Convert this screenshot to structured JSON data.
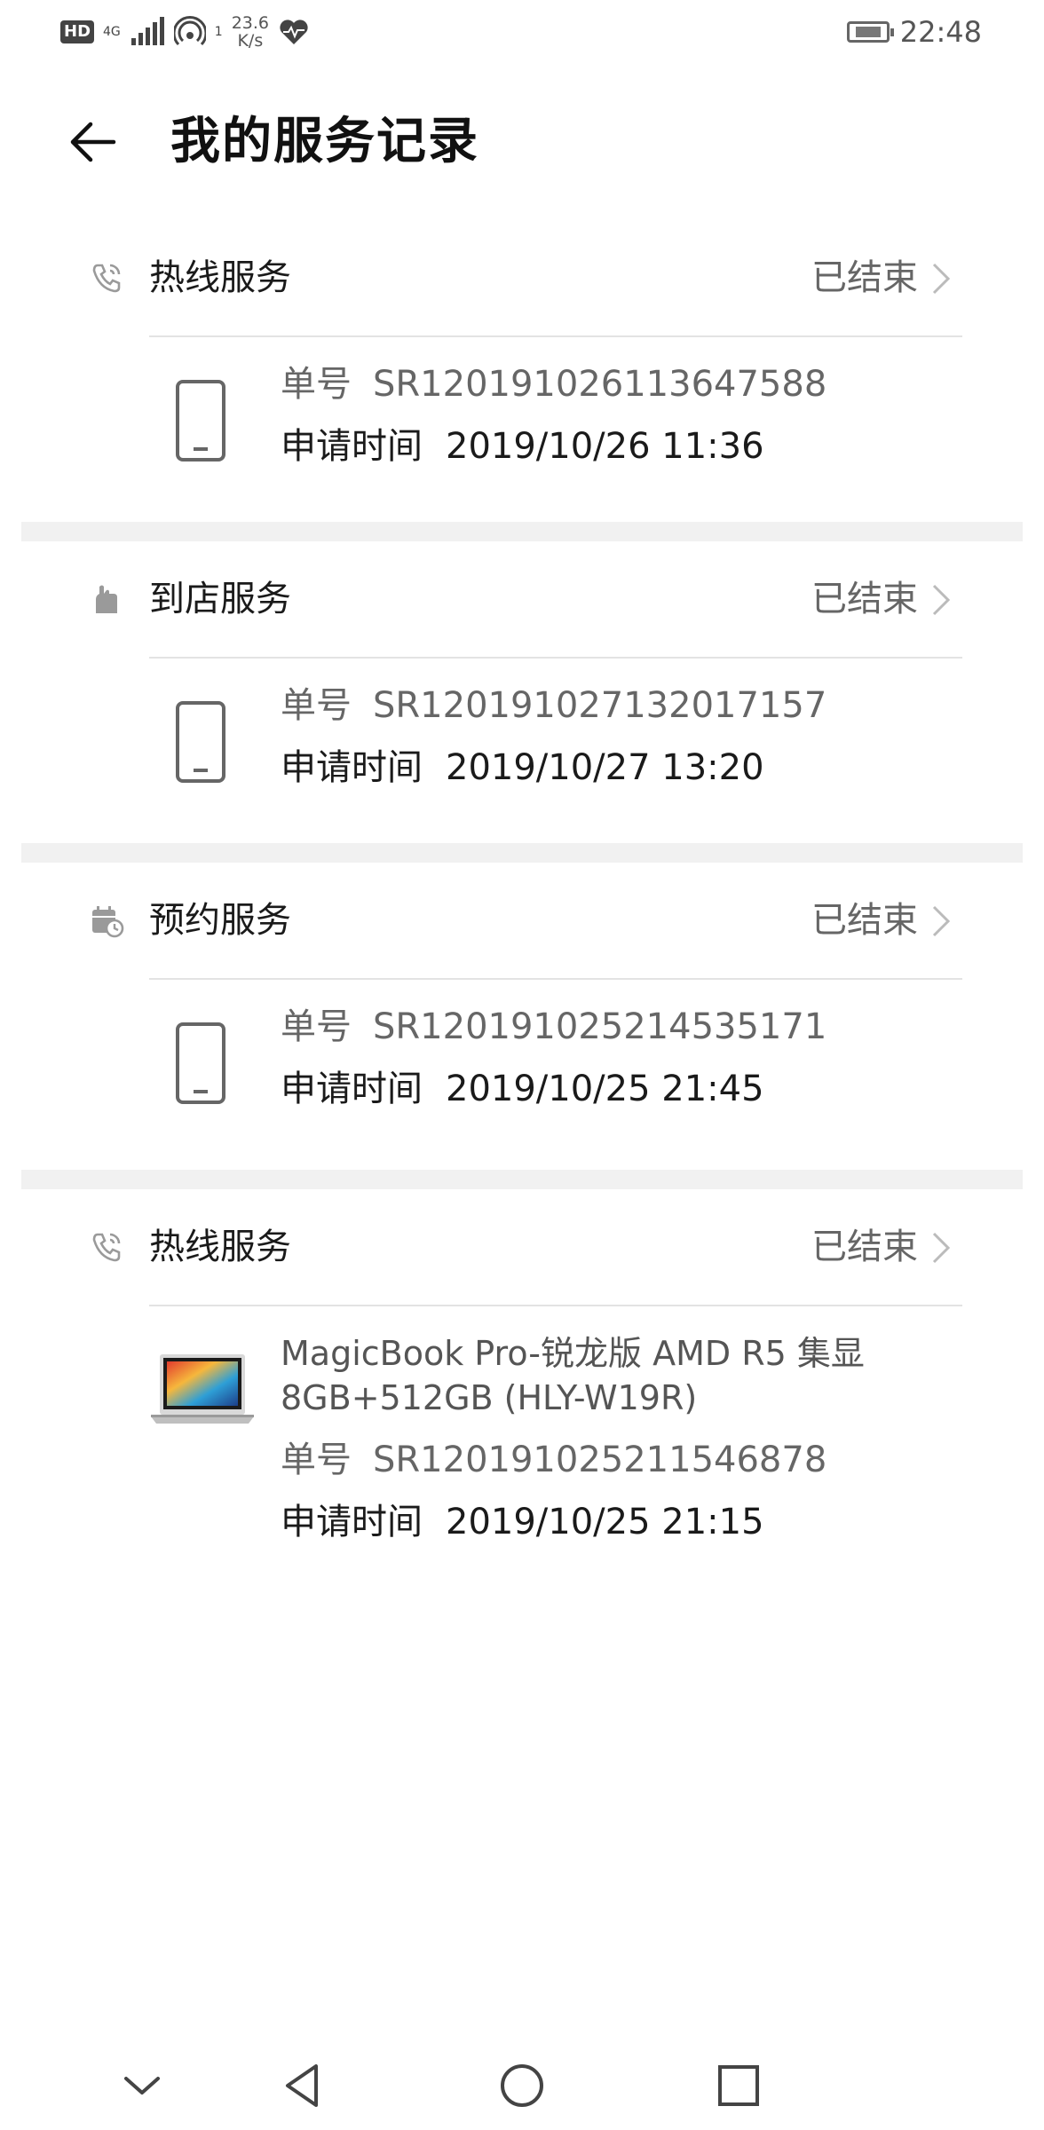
{
  "status_bar": {
    "hd": "HD",
    "network": "4G",
    "hotspot_count": "1",
    "speed_value": "23.6",
    "speed_unit": "K/s",
    "time": "22:48"
  },
  "header": {
    "title": "我的服务记录"
  },
  "records": [
    {
      "type_icon": "phone-call-icon",
      "type": "热线服务",
      "status": "已结束",
      "device_icon": "smartphone-icon",
      "product": "",
      "order_label": "单号",
      "order_no": "SR120191026113647588",
      "time_label": "申请时间",
      "time": "2019/10/26 11:36"
    },
    {
      "type_icon": "hand-store-icon",
      "type": "到店服务",
      "status": "已结束",
      "device_icon": "smartphone-icon",
      "product": "",
      "order_label": "单号",
      "order_no": "SR120191027132017157",
      "time_label": "申请时间",
      "time": "2019/10/27 13:20"
    },
    {
      "type_icon": "calendar-clock-icon",
      "type": "预约服务",
      "status": "已结束",
      "device_icon": "smartphone-icon",
      "product": "",
      "order_label": "单号",
      "order_no": "SR120191025214535171",
      "time_label": "申请时间",
      "time": "2019/10/25 21:45"
    },
    {
      "type_icon": "phone-call-icon",
      "type": "热线服务",
      "status": "已结束",
      "device_icon": "laptop-image",
      "product": "MagicBook Pro-锐龙版 AMD R5 集显 8GB+512GB (HLY-W19R)",
      "order_label": "单号",
      "order_no": "SR120191025211546878",
      "time_label": "申请时间",
      "time": "2019/10/25 21:15"
    }
  ],
  "nav_bar": {
    "items": [
      "collapse-icon",
      "back-triangle-icon",
      "home-circle-icon",
      "recents-square-icon"
    ]
  }
}
